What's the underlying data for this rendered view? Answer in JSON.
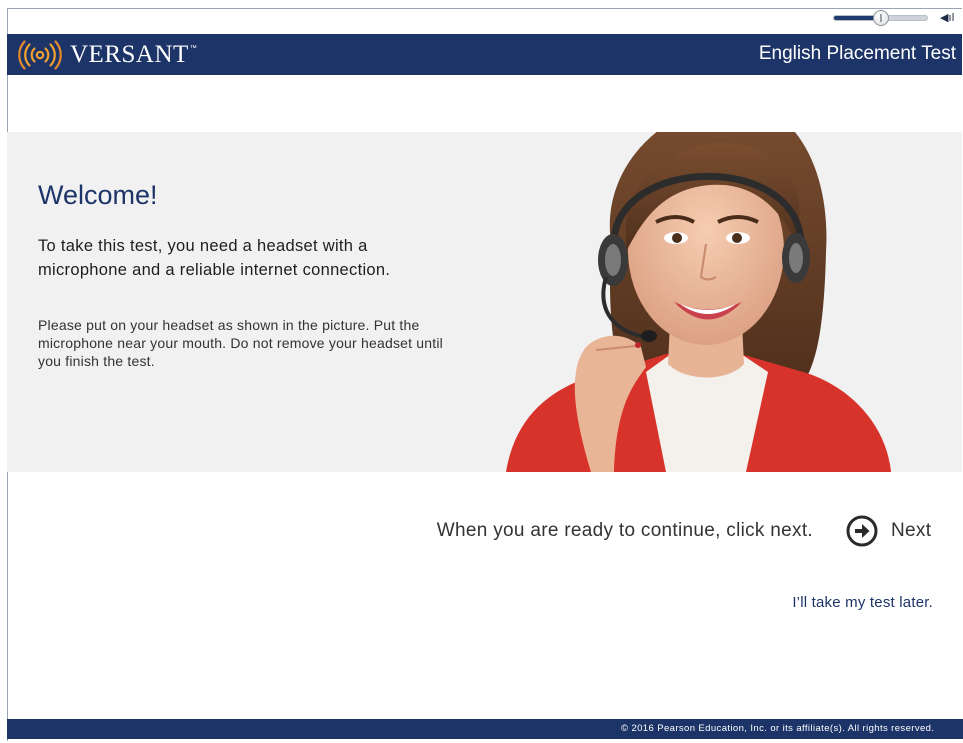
{
  "app": {
    "brand": "VERSANT",
    "brand_tm": "™",
    "title": "English Placement Test"
  },
  "volume": {
    "level": 0.5,
    "icon": "speaker-icon"
  },
  "welcome": {
    "heading": "Welcome!",
    "lead": "To take this test, you need a headset with a microphone and a reliable internet connection.",
    "instructions": "Please put on your headset as shown in the picture. Put the microphone near your mouth. Do not remove your headset until you finish the test.",
    "image_subject": "woman-wearing-headset"
  },
  "actions": {
    "continue_prompt": "When you are ready to continue, click next.",
    "next_label": "Next",
    "next_icon": "arrow-right-circle-icon",
    "later_link": "I’ll take my test later."
  },
  "footer": {
    "copyright": "© 2016 Pearson Education, Inc. or its affiliate(s). All rights reserved."
  },
  "colors": {
    "brand_navy": "#1d3469",
    "band_gray": "#f1f1f2",
    "logo_orange": "#f0a22e"
  }
}
